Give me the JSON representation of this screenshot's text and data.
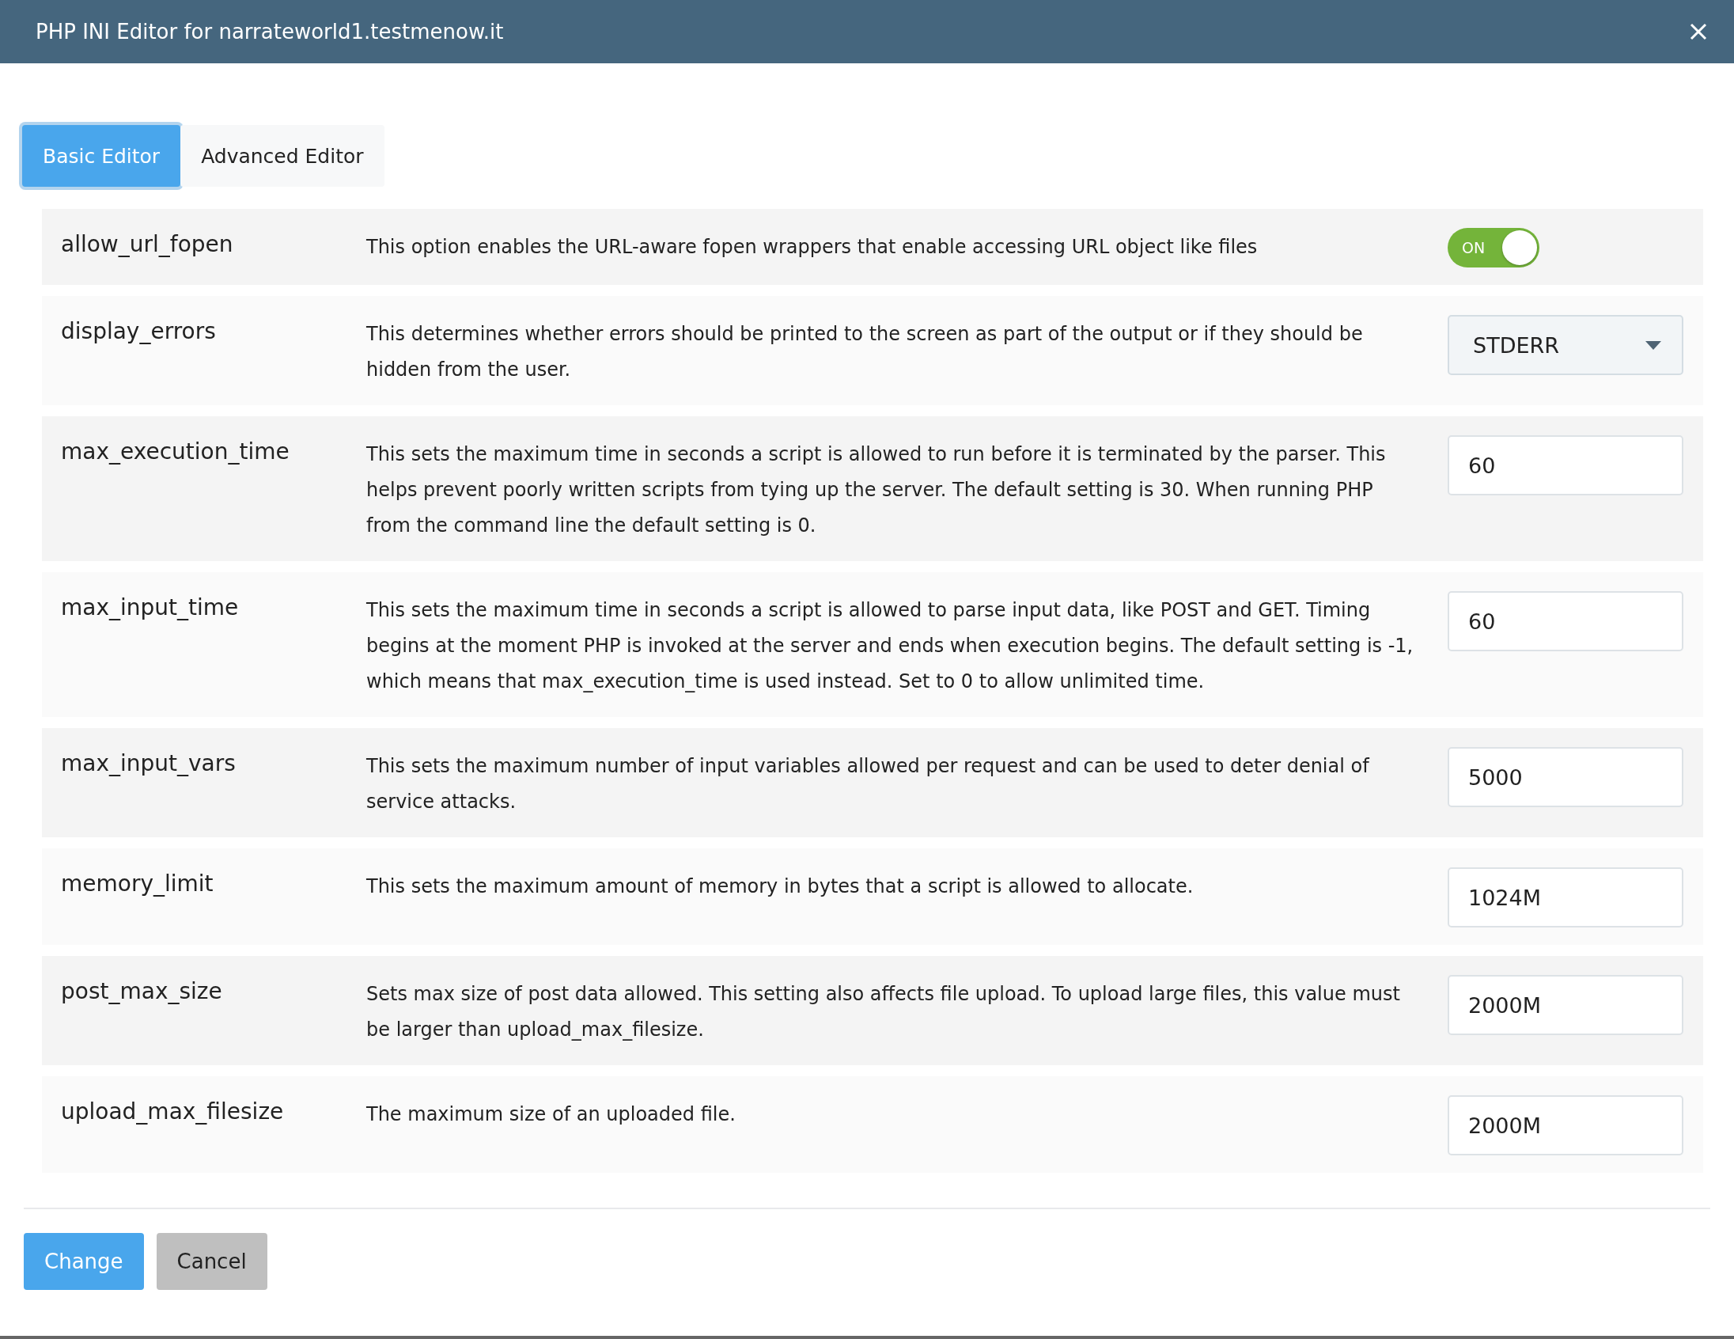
{
  "window": {
    "title": "PHP INI Editor for narrateworld1.testmenow.it"
  },
  "tabs": [
    {
      "label": "Basic Editor",
      "selected": true
    },
    {
      "label": "Advanced Editor",
      "selected": false
    }
  ],
  "settings": [
    {
      "name": "allow_url_fopen",
      "description": "This option enables the URL-aware fopen wrappers that enable accessing URL object like files",
      "kind": "toggle",
      "on": true,
      "value": "ON"
    },
    {
      "name": "display_errors",
      "description": "This determines whether errors should be printed to the screen as part of the output or if they should be hidden from the user.",
      "kind": "select",
      "value": "STDERR"
    },
    {
      "name": "max_execution_time",
      "description": "This sets the maximum time in seconds a script is allowed to run before it is terminated by the parser. This helps prevent poorly written scripts from tying up the server. The default setting is 30. When running PHP from the command line the default setting is 0.",
      "kind": "text",
      "value": "60"
    },
    {
      "name": "max_input_time",
      "description": "This sets the maximum time in seconds a script is allowed to parse input data, like POST and GET. Timing begins at the moment PHP is invoked at the server and ends when execution begins. The default setting is -1, which means that max_execution_time is used instead. Set to 0 to allow unlimited time.",
      "kind": "text",
      "value": "60"
    },
    {
      "name": "max_input_vars",
      "description": "This sets the maximum number of input variables allowed per request and can be used to deter denial of service attacks.",
      "kind": "text",
      "value": "5000"
    },
    {
      "name": "memory_limit",
      "description": "This sets the maximum amount of memory in bytes that a script is allowed to allocate.",
      "kind": "text",
      "value": "1024M"
    },
    {
      "name": "post_max_size",
      "description": "Sets max size of post data allowed. This setting also affects file upload. To upload large files, this value must be larger than upload_max_filesize.",
      "kind": "text",
      "value": "2000M"
    },
    {
      "name": "upload_max_filesize",
      "description": "The maximum size of an uploaded file.",
      "kind": "text",
      "value": "2000M"
    }
  ],
  "buttons": [
    {
      "label": "Change",
      "kind": "primary"
    },
    {
      "label": "Cancel",
      "kind": "secondary"
    }
  ]
}
